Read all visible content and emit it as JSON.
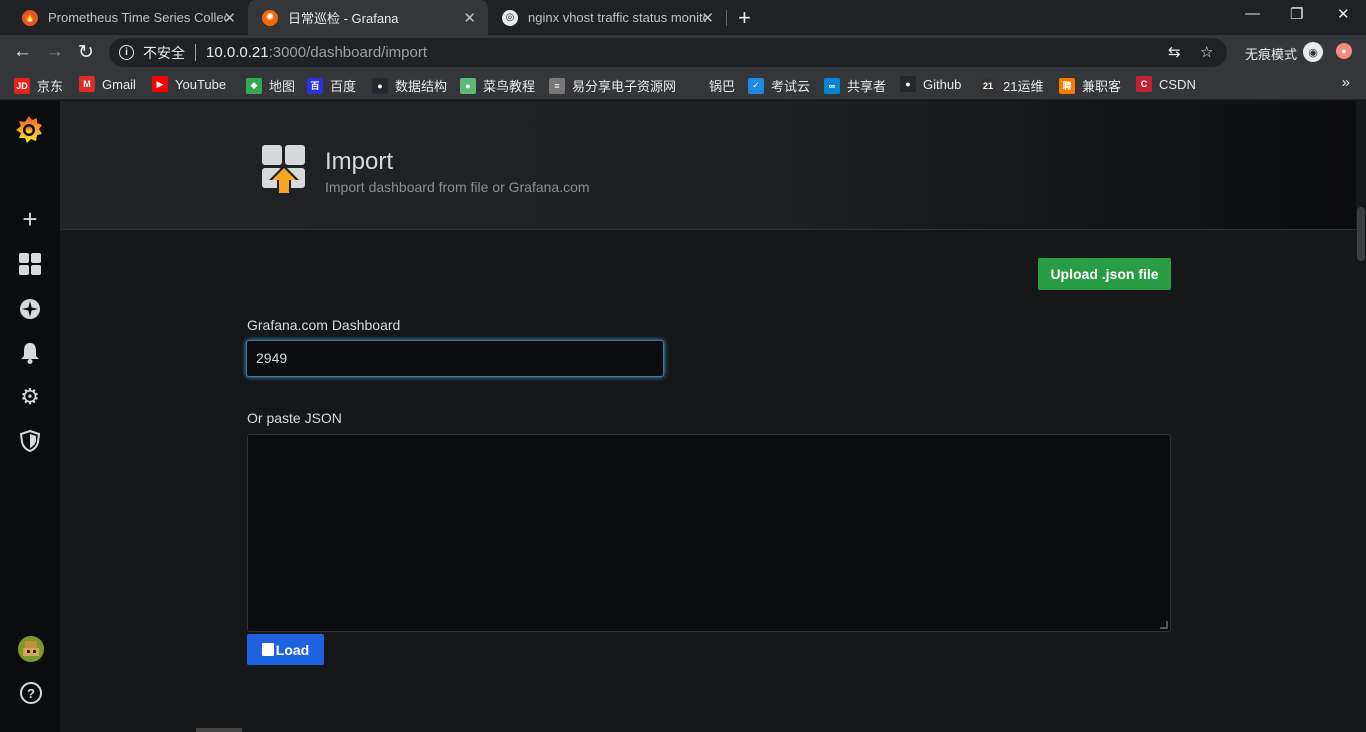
{
  "browser": {
    "tabs": [
      {
        "title": "Prometheus Time Series Collection",
        "favicon": "prometheus-icon",
        "active": false
      },
      {
        "title": "日常巡检 - Grafana",
        "favicon": "grafana-icon",
        "active": true
      },
      {
        "title": "nginx vhost traffic status monitor",
        "favicon": "globe-icon",
        "active": false
      }
    ],
    "new_tab": "+",
    "window_controls": {
      "minimize": "—",
      "restore": "❐",
      "close": "✕"
    },
    "address": {
      "security_label": "不安全",
      "host": "10.0.0.21",
      "path": ":3000/dashboard/import"
    },
    "incognito_label": "无痕模式",
    "bookmarks": [
      {
        "label": "京东",
        "icon": "JD",
        "color": "#e1251b"
      },
      {
        "label": "Gmail",
        "icon": "M",
        "color": "#d93025"
      },
      {
        "label": "YouTube",
        "icon": "▶",
        "color": "#ff0000"
      },
      {
        "label": "地图",
        "icon": "◆",
        "color": "#34a853"
      },
      {
        "label": "百度",
        "icon": "百",
        "color": "#2932e1"
      },
      {
        "label": "数据结构",
        "icon": "●",
        "color": "#24292e"
      },
      {
        "label": "菜鸟教程",
        "icon": "●",
        "color": "#5fb878"
      },
      {
        "label": "易分享电子资源网",
        "icon": "≡",
        "color": "#777"
      },
      {
        "label": "锅巴",
        "icon": "",
        "color": "#35363a"
      },
      {
        "label": "考试云",
        "icon": "✓",
        "color": "#1e88e5"
      },
      {
        "label": "共享者",
        "icon": "∞",
        "color": "#0288d1"
      },
      {
        "label": "Github",
        "icon": "●",
        "color": "#24292e"
      },
      {
        "label": "21运维",
        "icon": "21",
        "color": "#333"
      },
      {
        "label": "兼职客",
        "icon": "聘",
        "color": "#f57c00"
      },
      {
        "label": "CSDN",
        "icon": "C",
        "color": "#c32136"
      }
    ],
    "bookmarks_more": "»"
  },
  "grafana": {
    "header": {
      "title": "Import",
      "subtitle": "Import dashboard from file or Grafana.com"
    },
    "upload_button": "Upload .json file",
    "gcom_label": "Grafana.com Dashboard",
    "gcom_value": "2949",
    "json_label": "Or paste JSON",
    "json_value": "",
    "load_button": "Load",
    "help_glyph": "?"
  },
  "colors": {
    "upload_button": "#299c46",
    "load_button": "#1f62e0",
    "sidebar": "#0b0c0e",
    "page_bg": "#161719"
  }
}
